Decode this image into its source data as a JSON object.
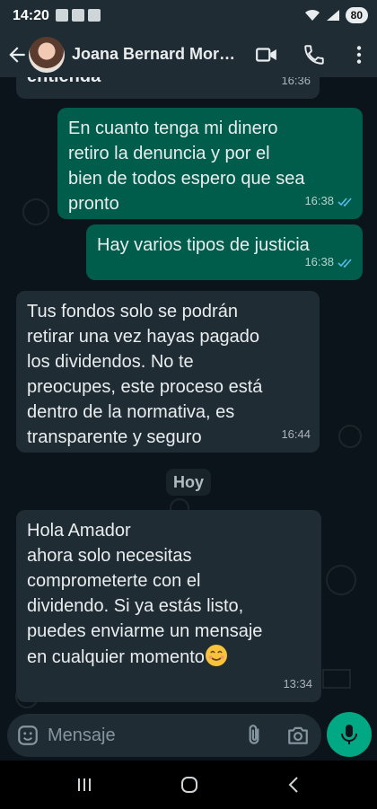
{
  "status_bar": {
    "time": "14:20",
    "battery": "80"
  },
  "header": {
    "contact_name": "Joana Bernard Moreno"
  },
  "messages": [
    {
      "direction": "in",
      "lines": [
        "entienda"
      ],
      "time": "16:36"
    },
    {
      "direction": "out",
      "lines": [
        "En cuanto tenga mi dinero",
        "retiro la denuncia y por el",
        "bien de todos espero que sea",
        "pronto"
      ],
      "time": "16:38",
      "status": "read"
    },
    {
      "direction": "out",
      "lines": [
        "Hay varios tipos de justicia"
      ],
      "time": "16:38",
      "status": "read"
    },
    {
      "direction": "in",
      "lines": [
        "Tus fondos solo se podrán",
        "retirar una vez hayas pagado",
        "los dividendos. No te",
        "preocupes, este proceso está",
        "dentro de la normativa, es",
        "transparente y seguro"
      ],
      "time": "16:44"
    },
    {
      "direction": "in",
      "lines": [
        "Hola Amador",
        "ahora solo necesitas",
        "comprometerte con el",
        "dividendo. Si ya estás listo,",
        "puedes enviarme un mensaje",
        "en cualquier momento"
      ],
      "time": "13:34"
    }
  ],
  "day_divider": "Hoy",
  "composer": {
    "placeholder": "Mensaje"
  },
  "colors": {
    "background": "#0b141a",
    "incoming_bubble": "#202c33",
    "outgoing_bubble": "#005c4b",
    "accent": "#00a884",
    "read_ticks": "#53bdeb"
  },
  "icons": [
    "back-arrow-icon",
    "video-call-icon",
    "phone-icon",
    "more-icon",
    "emoji-icon",
    "attach-icon",
    "camera-icon",
    "mic-icon",
    "smiling-emoji-icon",
    "read-ticks-icon"
  ]
}
